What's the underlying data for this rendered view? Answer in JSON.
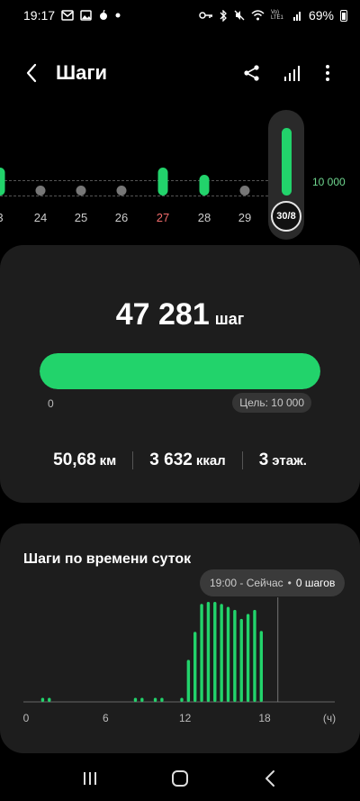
{
  "status_bar": {
    "time": "19:17",
    "left_icons": [
      "mail-icon",
      "gallery-icon",
      "android-icon",
      "dot-icon"
    ],
    "right_icons": [
      "key-icon",
      "bluetooth-icon",
      "mute-icon",
      "wifi-icon",
      "volte-icon",
      "signal-icon"
    ],
    "volte_text": "Vo) LTE1",
    "battery": "69%"
  },
  "header": {
    "title": "Шаги"
  },
  "day_strip": {
    "goal_label": "10 000",
    "days": [
      {
        "label": "3",
        "steps_fraction": 0.28,
        "type": "bar"
      },
      {
        "label": "24",
        "type": "dot"
      },
      {
        "label": "25",
        "type": "dot"
      },
      {
        "label": "26",
        "type": "dot"
      },
      {
        "label": "27",
        "steps_fraction": 0.28,
        "type": "bar",
        "highlight": true
      },
      {
        "label": "28",
        "steps_fraction": 0.18,
        "type": "bar"
      },
      {
        "label": "29",
        "type": "dot"
      }
    ],
    "selected": {
      "label": "30/8",
      "steps_fraction": 1.0
    }
  },
  "summary": {
    "steps": "47 281",
    "unit": "шаг",
    "progress_fraction": 1.0,
    "min_label": "0",
    "goal_label": "Цель: 10 000",
    "stats": [
      {
        "value": "50,68",
        "unit": "км"
      },
      {
        "value": "3 632",
        "unit": "ккал"
      },
      {
        "value": "3",
        "unit": "этаж."
      }
    ]
  },
  "hourly": {
    "title": "Шаги по времени суток",
    "tooltip": {
      "time": "19:00 - Сейчас",
      "separator": "•",
      "value": "0 шагов"
    },
    "colors": {
      "bar": "#22d36b",
      "axis": "#666",
      "cursor": "#777"
    }
  },
  "chart_data": {
    "type": "bar",
    "title": "Шаги по времени суток",
    "x_ticks": [
      "0",
      "6",
      "12",
      "18",
      "(ч)"
    ],
    "x_range": [
      0,
      24
    ],
    "bars": [
      {
        "x": 1.25,
        "v": 0.04
      },
      {
        "x": 1.75,
        "v": 0.04
      },
      {
        "x": 8.25,
        "v": 0.04
      },
      {
        "x": 8.75,
        "v": 0.04
      },
      {
        "x": 9.75,
        "v": 0.04
      },
      {
        "x": 10.25,
        "v": 0.04
      },
      {
        "x": 11.75,
        "v": 0.04
      },
      {
        "x": 12.25,
        "v": 0.42
      },
      {
        "x": 12.75,
        "v": 0.7
      },
      {
        "x": 13.25,
        "v": 0.98
      },
      {
        "x": 13.75,
        "v": 1.0
      },
      {
        "x": 14.25,
        "v": 1.0
      },
      {
        "x": 14.75,
        "v": 0.98
      },
      {
        "x": 15.25,
        "v": 0.95
      },
      {
        "x": 15.75,
        "v": 0.92
      },
      {
        "x": 16.25,
        "v": 0.83
      },
      {
        "x": 16.75,
        "v": 0.88
      },
      {
        "x": 17.25,
        "v": 0.92
      },
      {
        "x": 17.75,
        "v": 0.71
      }
    ],
    "cursor_x": 19
  }
}
